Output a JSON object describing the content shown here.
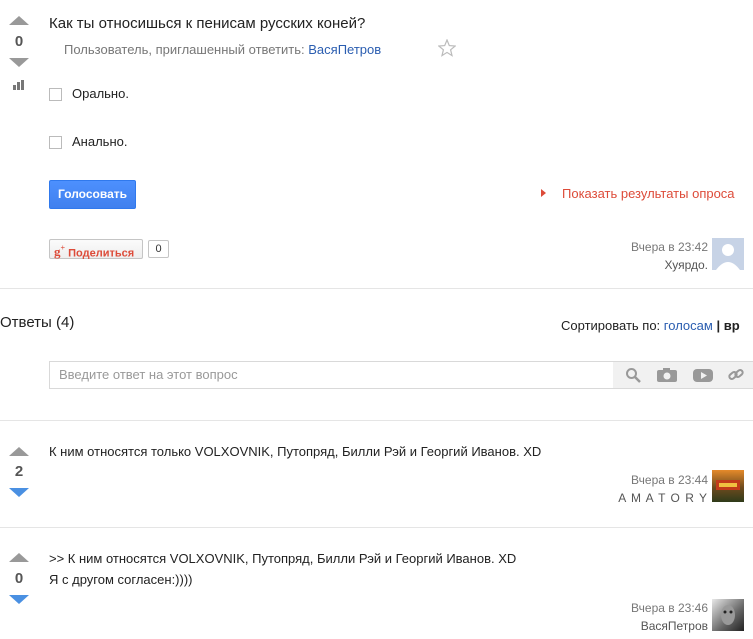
{
  "question": {
    "votes": "0",
    "title": "Как ты относишься к пенисам русских коней?",
    "invited_prefix": "Пользователь, приглашенный ответить:",
    "invited_user": "ВасяПетров",
    "options": [
      {
        "label": "Орально."
      },
      {
        "label": "Анально."
      }
    ],
    "vote_button": "Голосовать",
    "show_results": "Показать результаты опроса",
    "share_label": "Поделиться",
    "share_count": "0",
    "time": "Вчера в 23:42",
    "author": "Хуярдо."
  },
  "answers_header": {
    "title": "Ответы (4)",
    "sort_prefix": "Сортировать по:",
    "sort_votes": "голосам",
    "sort_sep": "|",
    "sort_time": "вр"
  },
  "answer_input": {
    "placeholder": "Введите ответ на этот вопрос"
  },
  "answers": [
    {
      "votes": "2",
      "text": "К ним относятся только VOLXOVNIK, Путопряд, Билли Рэй и Георгий Иванов. XD",
      "time": "Вчера в 23:44",
      "author": "A M A T O R Y"
    },
    {
      "votes": "0",
      "text_line1": ">> К ним относятся VOLXOVNIK, Путопряд, Билли Рэй и Георгий Иванов. XD",
      "text_line2": "Я с другом согласен:))))",
      "time": "Вчера в 23:46",
      "author": "ВасяПетров"
    }
  ],
  "colors": {
    "accent_blue": "#4d90fe",
    "link": "#2a5db0",
    "results_red": "#dd4b39",
    "vote_blue": "#4a90e2"
  },
  "icons": [
    "vote-up-icon",
    "vote-down-icon",
    "stats-icon",
    "star-icon",
    "checkbox-icon",
    "triangle-right-icon",
    "gplus-icon",
    "avatar",
    "search-icon",
    "camera-icon",
    "video-icon",
    "link-icon"
  ]
}
